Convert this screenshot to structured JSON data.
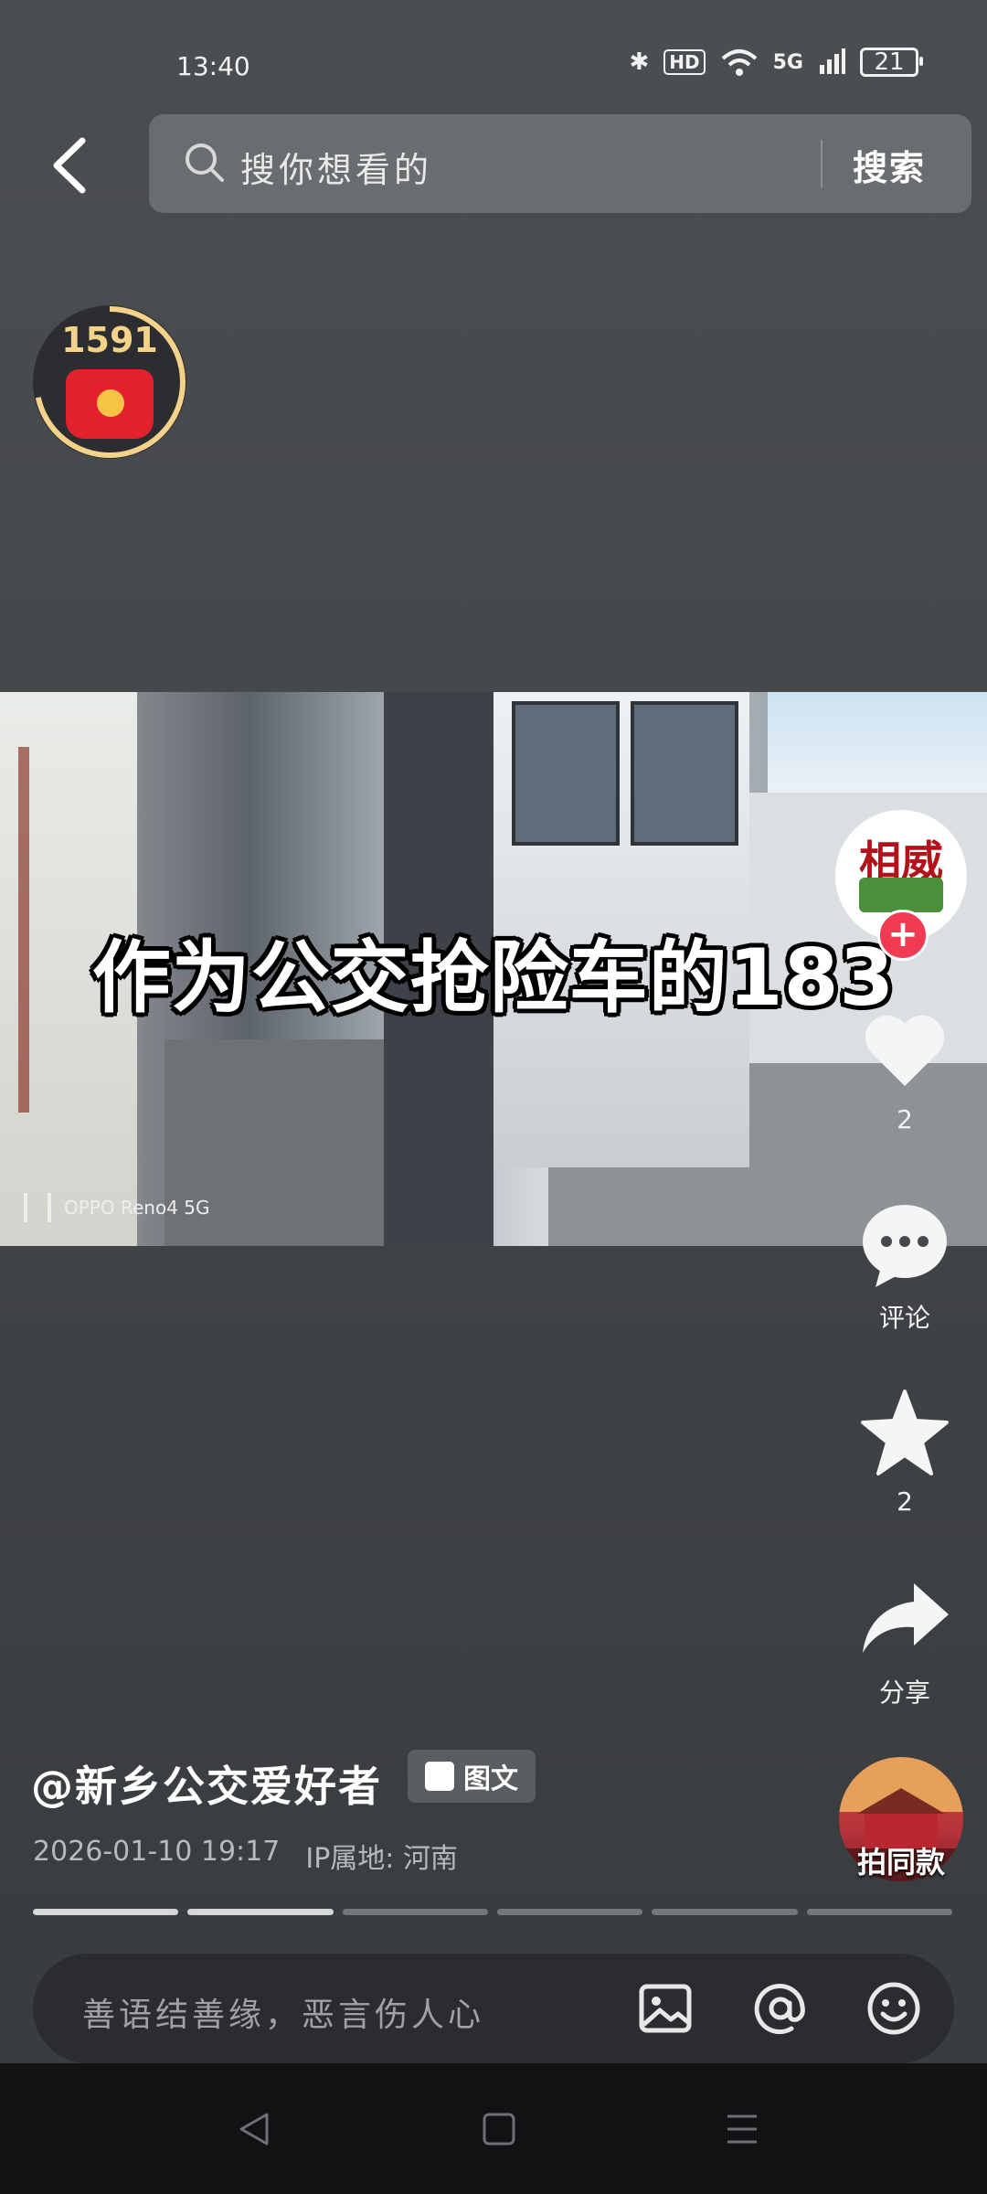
{
  "status_bar": {
    "time": "13:40",
    "bluetooth_icon": "bluetooth-icon",
    "hd_label": "HD",
    "wifi_icon": "wifi-icon",
    "network_label": "5G",
    "battery_level": "21"
  },
  "header": {
    "search_placeholder": "搜你想看的",
    "search_button": "搜索"
  },
  "red_packet": {
    "count": "1591"
  },
  "video": {
    "caption": "作为公交抢险车的183",
    "watermark": "OPPO Reno4 5G"
  },
  "right_rail": {
    "avatar_text": "相威",
    "like_count": "2",
    "comment_label": "评论",
    "favorite_count": "2",
    "share_label": "分享",
    "same_style_label": "拍同款"
  },
  "post": {
    "author": "@新乡公交爱好者",
    "tag": "图文",
    "datetime": "2026-01-10 19:17",
    "ip_label": "IP属地:",
    "ip_location": "河南",
    "progress": {
      "segments": 6,
      "active": 2
    }
  },
  "comment_bar": {
    "placeholder": "善语结善缘，恶言伤人心"
  },
  "colors": {
    "background": "#45484b",
    "accent": "#f03b52",
    "gold": "#f4d28a"
  }
}
